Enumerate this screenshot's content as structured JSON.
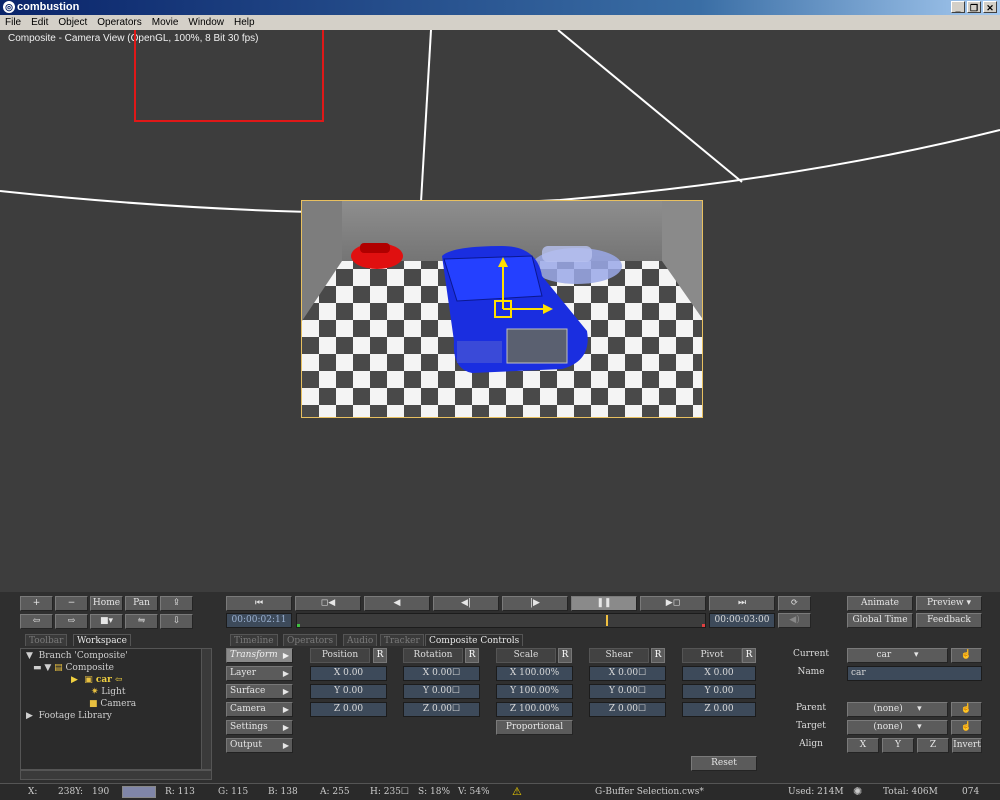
{
  "window": {
    "title": "combustion",
    "controls": [
      "_",
      "❐",
      "✕"
    ]
  },
  "menu": [
    "File",
    "Edit",
    "Object",
    "Operators",
    "Movie",
    "Window",
    "Help"
  ],
  "viewport": {
    "title": "Composite - Camera View (OpenGL, 100%, 8 Bit 30 fps)"
  },
  "left_buttons": {
    "plus": "+",
    "minus": "−",
    "home": "Home",
    "pan": "Pan"
  },
  "left_tabs": [
    "Toolbar",
    "Workspace"
  ],
  "tree": {
    "branch": "Branch 'Composite'",
    "composite": "Composite",
    "car": "car",
    "light": "Light",
    "camera": "Camera",
    "footage": "Footage Library"
  },
  "transport": {
    "buttons": [
      "⏮",
      "◻◀",
      "◀",
      "◀|",
      "|▶",
      "❚❚",
      "▶◻",
      "⏭",
      "⟳"
    ],
    "current_time": "00:00:02:11",
    "end_time": "00:00:03:00",
    "playhead_fraction": 0.76
  },
  "right_top": {
    "animate": "Animate",
    "preview": "Preview",
    "global_time": "Global Time",
    "feedback": "Feedback"
  },
  "tabs": [
    "Timeline",
    "Operators",
    "Audio",
    "Tracker",
    "Composite Controls"
  ],
  "categories": [
    "Transform",
    "Layer",
    "Surface",
    "Camera",
    "Settings",
    "Output"
  ],
  "columns": {
    "position": {
      "label": "Position",
      "r": "R",
      "x": "X 0.00",
      "y": "Y 0.00",
      "z": "Z 0.00"
    },
    "rotation": {
      "label": "Rotation",
      "r": "R",
      "x": "X 0.00☐",
      "y": "Y 0.00☐",
      "z": "Z 0.00☐"
    },
    "scale": {
      "label": "Scale",
      "r": "R",
      "x": "X 100.00%",
      "y": "Y 100.00%",
      "z": "Z 100.00%"
    },
    "shear": {
      "label": "Shear",
      "r": "R",
      "x": "X 0.00☐",
      "y": "Y 0.00☐",
      "z": "Z 0.00☐"
    },
    "pivot": {
      "label": "Pivot",
      "r": "R",
      "x": "X 0.00",
      "y": "Y 0.00",
      "z": "Z 0.00"
    }
  },
  "proportional": "Proportional",
  "reset": "Reset",
  "props": {
    "current_label": "Current",
    "current_value": "car",
    "name_label": "Name",
    "name_value": "car",
    "parent_label": "Parent",
    "parent_value": "(none)",
    "target_label": "Target",
    "target_value": "(none)",
    "align_label": "Align",
    "x": "X",
    "y": "Y",
    "z": "Z",
    "invert": "Invert"
  },
  "status": {
    "x": "X:",
    "xy": "238Y:",
    "yval": "190",
    "swatch_color": "#8086a8",
    "r": "R: 113",
    "g": "G: 115",
    "b": "B: 138",
    "a": "A: 255",
    "h": "H: 235☐",
    "s": "S: 18%",
    "v": "V: 54%",
    "file": "G-Buffer Selection.cws*",
    "used": "Used: 214M",
    "total": "Total: 406M",
    "num": "074"
  }
}
